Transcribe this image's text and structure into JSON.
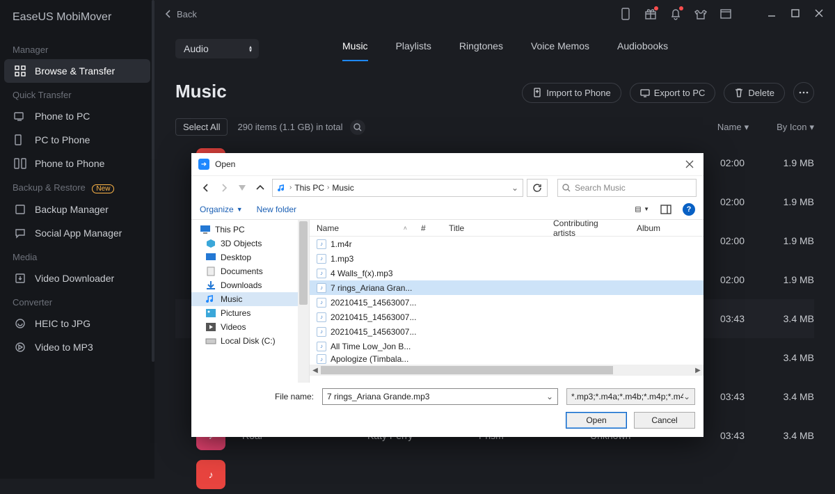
{
  "app": {
    "title": "EaseUS MobiMover",
    "back": "Back"
  },
  "sidebar": {
    "sections": [
      {
        "label": "Manager",
        "items": [
          {
            "label": "Browse & Transfer",
            "icon": "grid",
            "active": true
          }
        ]
      },
      {
        "label": "Quick Transfer",
        "items": [
          {
            "label": "Phone to PC",
            "icon": "phone-pc"
          },
          {
            "label": "PC to Phone",
            "icon": "pc-phone"
          },
          {
            "label": "Phone to Phone",
            "icon": "phone-phone"
          }
        ]
      },
      {
        "label": "Backup & Restore",
        "badge": "New",
        "items": [
          {
            "label": "Backup Manager",
            "icon": "backup"
          },
          {
            "label": "Social App Manager",
            "icon": "chat"
          }
        ]
      },
      {
        "label": "Media",
        "items": [
          {
            "label": "Video Downloader",
            "icon": "download"
          }
        ]
      },
      {
        "label": "Converter",
        "items": [
          {
            "label": "HEIC to JPG",
            "icon": "image"
          },
          {
            "label": "Video to MP3",
            "icon": "video"
          }
        ]
      }
    ]
  },
  "category": {
    "selector": "Audio",
    "tabs": [
      "Music",
      "Playlists",
      "Ringtones",
      "Voice Memos",
      "Audiobooks"
    ],
    "active": 0
  },
  "page": {
    "title": "Music",
    "actions": {
      "import": "Import to Phone",
      "export": "Export to PC",
      "delete": "Delete"
    },
    "selectAll": "Select All",
    "count": "290 items (1.1 GB) in total",
    "sortName": "Name",
    "sortView": "By Icon"
  },
  "rows": [
    {
      "time": "02:00",
      "size": "1.9 MB"
    },
    {
      "time": "02:00",
      "size": "1.9 MB"
    },
    {
      "time": "02:00",
      "size": "1.9 MB"
    },
    {
      "time": "02:00",
      "size": "1.9 MB"
    },
    {
      "name": "",
      "time": "03:43",
      "size": "3.4 MB",
      "sel": true
    },
    {
      "time": "",
      "size": "3.4 MB"
    },
    {
      "time": "03:43",
      "size": "3.4 MB"
    },
    {
      "name": "Roar",
      "artist": "Katy Perry",
      "album": "Prism",
      "genre": "Unknown",
      "time": "03:43",
      "size": "3.4 MB"
    }
  ],
  "dialog": {
    "title": "Open",
    "path": {
      "root": "This PC",
      "folder": "Music"
    },
    "searchPlaceholder": "Search Music",
    "organize": "Organize",
    "newFolder": "New folder",
    "columns": {
      "name": "Name",
      "num": "#",
      "title": "Title",
      "artists": "Contributing artists",
      "album": "Album"
    },
    "tree": [
      {
        "label": "This PC",
        "icon": "pc",
        "indent": 1
      },
      {
        "label": "3D Objects",
        "icon": "3d"
      },
      {
        "label": "Desktop",
        "icon": "desktop"
      },
      {
        "label": "Documents",
        "icon": "docs"
      },
      {
        "label": "Downloads",
        "icon": "dl"
      },
      {
        "label": "Music",
        "icon": "music",
        "sel": true
      },
      {
        "label": "Pictures",
        "icon": "pics"
      },
      {
        "label": "Videos",
        "icon": "vids"
      },
      {
        "label": "Local Disk (C:)",
        "icon": "disk"
      }
    ],
    "files": [
      {
        "name": "1.m4r"
      },
      {
        "name": "1.mp3"
      },
      {
        "name": "4 Walls_f(x).mp3"
      },
      {
        "name": "7 rings_Ariana Gran...",
        "sel": true
      },
      {
        "name": "20210415_14563007..."
      },
      {
        "name": "20210415_14563007..."
      },
      {
        "name": "20210415_14563007..."
      },
      {
        "name": "All Time Low_Jon B..."
      },
      {
        "name": "Apologize (Timbala..."
      }
    ],
    "fileNameLabel": "File name:",
    "fileName": "7 rings_Ariana Grande.mp3",
    "filter": "*.mp3;*.m4a;*.m4b;*.m4p;*.m4",
    "open": "Open",
    "cancel": "Cancel"
  }
}
